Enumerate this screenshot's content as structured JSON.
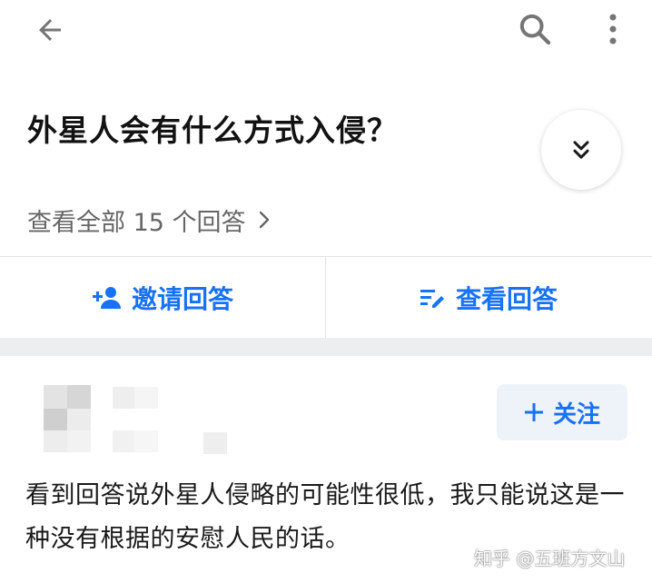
{
  "header": {
    "back_icon": "arrow-left-icon",
    "search_icon": "search-icon",
    "more_icon": "more-vertical-icon"
  },
  "question": {
    "title": "外星人会有什么方式入侵？",
    "view_all": "查看全部 15 个回答",
    "expand_icon": "double-chevron-down-icon"
  },
  "actions": {
    "invite": "邀请回答",
    "view": "查看回答"
  },
  "answer": {
    "follow_label": "关注",
    "text": "看到回答说外星人侵略的可能性很低，我只能说这是一种没有根据的安慰人民的话。"
  },
  "watermark": "知乎 @五班方文山",
  "colors": {
    "accent": "#1772f6",
    "follow_bg": "#eef3f9",
    "section_gap": "#eceef0"
  }
}
